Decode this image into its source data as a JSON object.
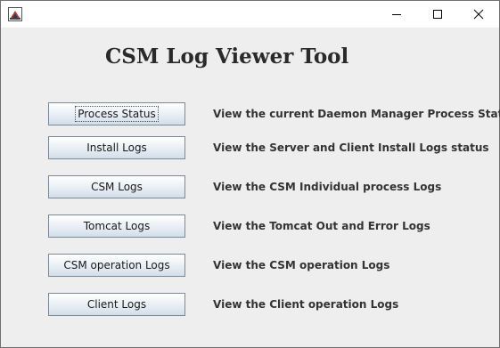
{
  "window": {
    "controls": {
      "minimize_icon": "minimize-icon",
      "maximize_icon": "maximize-icon",
      "close_icon": "close-icon"
    }
  },
  "page": {
    "title": "CSM Log Viewer Tool"
  },
  "rows": [
    {
      "button": "Process Status",
      "description": "View the current Daemon Manager Process Status"
    },
    {
      "button": "Install Logs",
      "description": "View the Server and Client Install Logs status"
    },
    {
      "button": "CSM Logs",
      "description": "View the CSM Individual process Logs"
    },
    {
      "button": "Tomcat Logs",
      "description": "View the Tomcat Out and Error Logs"
    },
    {
      "button": "CSM operation Logs",
      "description": "View the CSM operation Logs"
    },
    {
      "button": "Client Logs",
      "description": "View the Client operation Logs"
    }
  ],
  "colors": {
    "content_bg": "#eeeeee",
    "titlebar_bg": "#ffffff",
    "button_border": "#7a8a99"
  }
}
